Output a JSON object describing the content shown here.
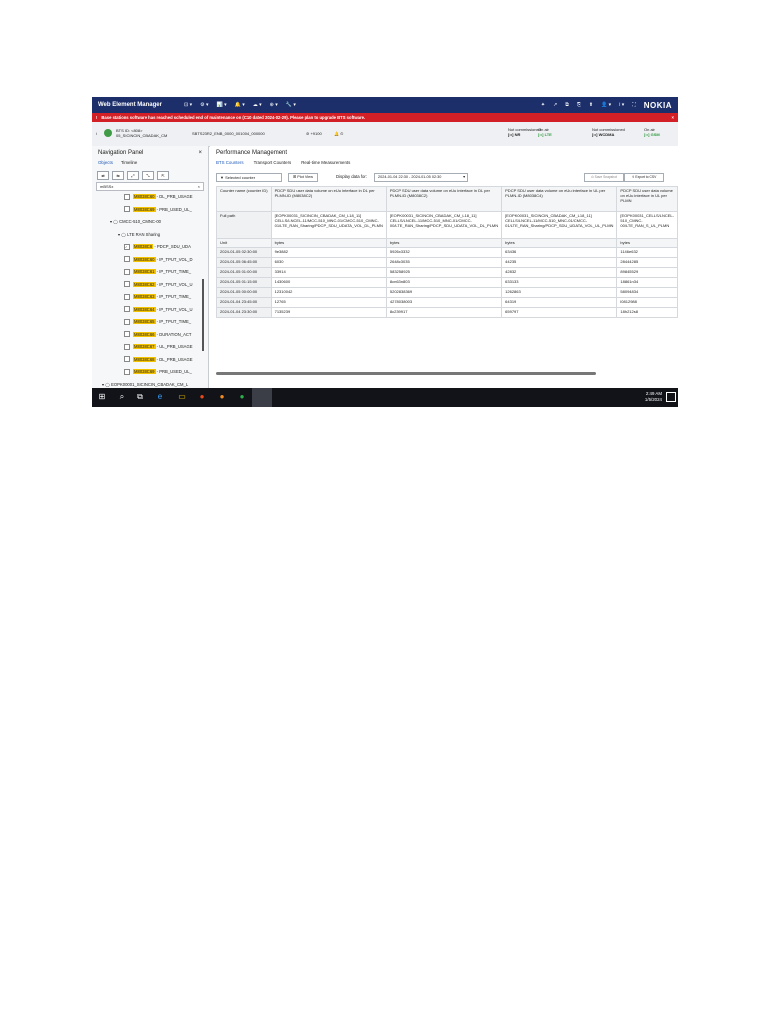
{
  "app": {
    "title": "Web Element Manager",
    "brand": "NOKIA",
    "top_menus": [
      "⊡ ▾",
      "⚙ ▾",
      "📊 ▾",
      "🔔 ▾",
      "☁ ▾",
      "⊕ ▾",
      "🔧 ▾"
    ],
    "right_icons": [
      "✦",
      "↗",
      "⧉",
      "⎘",
      "⬆",
      "👤 ▾",
      "i ▾",
      "⛶"
    ]
  },
  "alert": {
    "text": "Base stations software has reached scheduled end of maintenance on (C10 dated 2024-02-29). Please plan to upgrade BTS software."
  },
  "site": {
    "bts_id": "BTS ID: <808>",
    "bts_name": "05_SICINCIN_CBADAK_CM",
    "version": "SBTS23R2_ENB_0000_001004_000000",
    "alarms": "⊘ +9100",
    "bell": "🔔 ⊙",
    "status": [
      {
        "label": "Not commissioned",
        "tech": "[••] NR",
        "color": ""
      },
      {
        "label": "On air",
        "tech": "[••] LTE",
        "color": "#2f9b3f"
      },
      {
        "label": "Not commissioned",
        "tech": "[••] WCDMA",
        "color": ""
      },
      {
        "label": "On air",
        "tech": "[••] GSM",
        "color": "#2f9b3f"
      }
    ]
  },
  "nav": {
    "title": "Navigation Panel",
    "close": "×",
    "tabs": [
      "Objects",
      "Timeline"
    ],
    "tools": [
      "⇄",
      "⇆",
      "⤢",
      "⤡",
      "⇱"
    ],
    "search": "mBSSx",
    "search_clear": "×",
    "tree": [
      {
        "code": "M8038C60",
        "rest": " - DL_PRB_USAGE",
        "checked": false,
        "hl": true,
        "indent": 28
      },
      {
        "code": "M8038C69",
        "rest": " - PRB_USED_UL_",
        "checked": false,
        "hl": true,
        "indent": 28
      },
      {
        "code": "",
        "rest": "▾ ◯ CMCC-510_CMNC-00",
        "checked": false,
        "hl": false,
        "indent": 14,
        "nocheck": true
      },
      {
        "code": "",
        "rest": "▾ ◯ LTE RAN Sharing",
        "checked": false,
        "hl": false,
        "indent": 22,
        "nocheck": true
      },
      {
        "code": "M8038C6",
        "rest": " - PDCP_SDU_UDA",
        "checked": true,
        "hl": true,
        "indent": 28
      },
      {
        "code": "M8038C60",
        "rest": " - IP_TPUT_VOL_D",
        "checked": false,
        "hl": true,
        "indent": 28
      },
      {
        "code": "M8038C61",
        "rest": " - IP_TPUT_TIME_",
        "checked": false,
        "hl": true,
        "indent": 28
      },
      {
        "code": "M8038C62",
        "rest": " - IP_TPUT_VOL_U",
        "checked": false,
        "hl": true,
        "indent": 28
      },
      {
        "code": "M8038C63",
        "rest": " - IP_TPUT_TIME_",
        "checked": false,
        "hl": true,
        "indent": 28
      },
      {
        "code": "M8038C64",
        "rest": " - IP_TPUT_VOL_U",
        "checked": false,
        "hl": true,
        "indent": 28
      },
      {
        "code": "M8038C65",
        "rest": " - IP_TPUT_TIME_",
        "checked": false,
        "hl": true,
        "indent": 28
      },
      {
        "code": "M8038C66",
        "rest": " - DURATION_ACT",
        "checked": false,
        "hl": true,
        "indent": 28
      },
      {
        "code": "M8038C67",
        "rest": " - UL_PRB_USAGE",
        "checked": false,
        "hl": true,
        "indent": 28
      },
      {
        "code": "M8038C68",
        "rest": " - DL_PRB_USAGE",
        "checked": false,
        "hl": true,
        "indent": 28
      },
      {
        "code": "M8038C69",
        "rest": " - PRB_USED_UL_",
        "checked": false,
        "hl": true,
        "indent": 28
      },
      {
        "code": "",
        "rest": "▾ ◯ EOPK00001_SICINCIN_CBADAK_CM_L",
        "checked": false,
        "hl": false,
        "indent": 6,
        "nocheck": true
      }
    ]
  },
  "perf": {
    "title": "Performance Management",
    "tabs": [
      "BTS Counters",
      "Transport Counters",
      "Real-time Measurements"
    ],
    "selected_counter": "▼  Selected counter",
    "plot_view": "⊞ Plot View",
    "display_label": "Display data for:",
    "date_range": "2024-01-04 22:30 - 2024-01-05 02:30",
    "date_dd": "▾",
    "snapshot": "⊙ Save Snapshot",
    "export_csv": "⇪ Export to CSV",
    "row_labels": {
      "counter": "Counter name (counter ID)",
      "path": "Full path",
      "unit": "Unit"
    },
    "columns": [
      {
        "name": "PDCP SDU user data volume on eUu interface in DL per PLMN-ID (M8038C2)",
        "path": "[EOPK00031_SICINCIN_CBADAK_CM_L18_11] CELLS/LNCEL-11/MCC-510_MNC-01/CMCC-510_CMNC-01/LTE_RAN_Sharing/PDCP_SDU_UDATA_VOL_DL_PLMN",
        "unit": "bytes",
        "values": [
          "9e3882",
          "6030",
          "33914",
          "1430600",
          "12310042",
          "12765",
          "7135239"
        ]
      },
      {
        "name": "PDCP SDU user data volume on eUu interface in DL per PLMN-ID (M8038C2)",
        "path": "[EOPK00031_SICINCIN_CBADAK_CM_L18_11] CELLS/LNCEL-11/MCC-510_MNC-01/CMCC-00/LTE_RAN_Sharing/PDCP_SDU_UDATA_VOL_DL_PLMN",
        "unit": "bytes",
        "values": [
          "5926x3332",
          "2648c3035",
          "583258925",
          "8cn63n803",
          "5202838369",
          "4278038003",
          "8c239917"
        ]
      },
      {
        "name": "PDCP SDU user data volume on eUu interface in UL per PLMN-ID (M8038C4)",
        "path": "[EOPK00031_SICINCIN_CBADAK_CM_L18_11] CELLS/LNCEL-11/MCC-510_MNC-01/CMCC-01/LTE_RAN_Sharing/PDCP_SDU_UDATA_VOL_UL_PLMN",
        "unit": "bytes",
        "values": [
          "63436",
          "44235",
          "42832",
          "633133",
          "1262863",
          "64319",
          "659797"
        ]
      },
      {
        "name": "PDCP SDU user data volume on eUu interface in UL per PLMN",
        "path": "[EOPK00031_CELLS/LNCEL-510_CMNC-00/LTE_RAN_S_UL_PLMN",
        "unit": "bytes",
        "values": [
          "1146e632",
          "28444285",
          "89845529",
          "18861n34",
          "58094834",
          "l0812988",
          "18h212s8"
        ]
      }
    ],
    "timestamps": [
      "2024-01-05 02:30:00",
      "2024-01-05 06:45:00",
      "2024-01-05 01:00:00",
      "2024-01-05 01:15:00",
      "2024-01-05 00:00:00",
      "2024-01-04 23:45:00",
      "2024-01-04 23:30:00"
    ]
  },
  "taskbar": {
    "time": "2:49 AM",
    "date": "1/5/2024",
    "icons": [
      "⊞",
      "⌕",
      "⧉",
      "e",
      "▭",
      "●",
      "●",
      "●"
    ]
  }
}
